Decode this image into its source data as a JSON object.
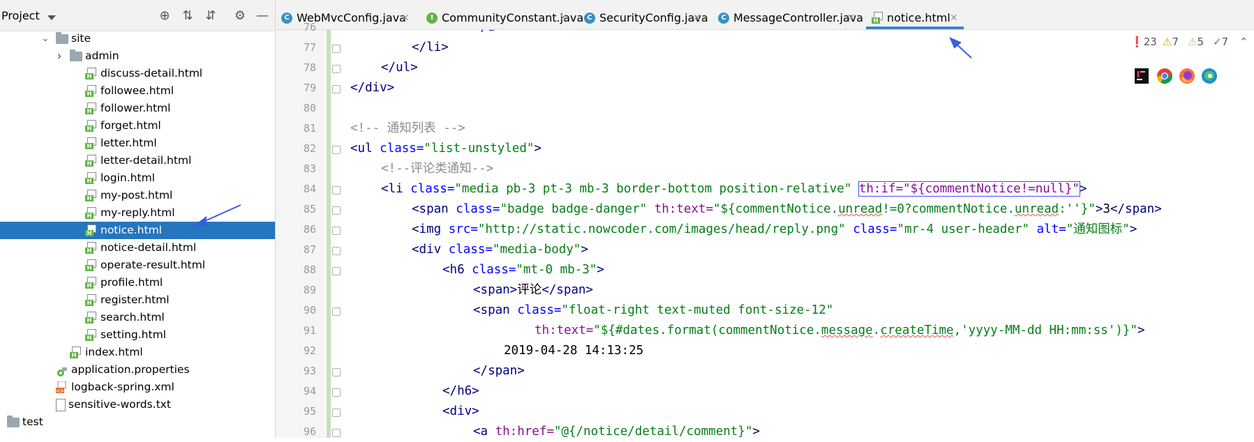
{
  "project_panel": {
    "title": "Project",
    "tree": [
      {
        "label": "site",
        "type": "folder",
        "expanded": true,
        "level": 4
      },
      {
        "label": "admin",
        "type": "folder",
        "expanded": false,
        "level": 5
      },
      {
        "label": "discuss-detail.html",
        "type": "html",
        "level": 6
      },
      {
        "label": "followee.html",
        "type": "html",
        "level": 6
      },
      {
        "label": "follower.html",
        "type": "html",
        "level": 6
      },
      {
        "label": "forget.html",
        "type": "html",
        "level": 6
      },
      {
        "label": "letter.html",
        "type": "html",
        "level": 6
      },
      {
        "label": "letter-detail.html",
        "type": "html",
        "level": 6
      },
      {
        "label": "login.html",
        "type": "html",
        "level": 6
      },
      {
        "label": "my-post.html",
        "type": "html",
        "level": 6
      },
      {
        "label": "my-reply.html",
        "type": "html",
        "level": 6
      },
      {
        "label": "notice.html",
        "type": "html",
        "level": 6,
        "selected": true
      },
      {
        "label": "notice-detail.html",
        "type": "html",
        "level": 6
      },
      {
        "label": "operate-result.html",
        "type": "html",
        "level": 6
      },
      {
        "label": "profile.html",
        "type": "html",
        "level": 6
      },
      {
        "label": "register.html",
        "type": "html",
        "level": 6
      },
      {
        "label": "search.html",
        "type": "html",
        "level": 6
      },
      {
        "label": "setting.html",
        "type": "html",
        "level": 6
      },
      {
        "label": "index.html",
        "type": "html",
        "level": 5
      },
      {
        "label": "application.properties",
        "type": "properties",
        "level": 4
      },
      {
        "label": "logback-spring.xml",
        "type": "xml",
        "level": 4
      },
      {
        "label": "sensitive-words.txt",
        "type": "txt",
        "level": 4
      },
      {
        "label": "test",
        "type": "folder",
        "expanded": true,
        "level": 1
      }
    ]
  },
  "tabs": [
    {
      "label": "WebMvcConfig.java",
      "icon": "class-icon",
      "icon_letter": "C"
    },
    {
      "label": "CommunityConstant.java",
      "icon": "interface-icon",
      "icon_letter": "I"
    },
    {
      "label": "SecurityConfig.java",
      "icon": "class-icon",
      "icon_letter": "C"
    },
    {
      "label": "MessageController.java",
      "icon": "class-icon",
      "icon_letter": "C"
    },
    {
      "label": "notice.html",
      "icon": "html-file-icon",
      "active": true
    }
  ],
  "inspections": {
    "errors": "23",
    "warnings": "7",
    "weak_warnings": "5",
    "typos": "7"
  },
  "editor": {
    "lines": [
      {
        "no": "76",
        "indent": 7,
        "tokens": [
          [
            "tag",
            "</a>"
          ]
        ]
      },
      {
        "no": "77",
        "indent": 5,
        "tokens": [
          [
            "tag",
            "</li>"
          ]
        ]
      },
      {
        "no": "78",
        "indent": 4,
        "tokens": [
          [
            "tag",
            "</ul>"
          ]
        ]
      },
      {
        "no": "79",
        "indent": 3,
        "tokens": [
          [
            "tag",
            "</div>"
          ]
        ]
      },
      {
        "no": "80",
        "indent": 0,
        "tokens": []
      },
      {
        "no": "81",
        "indent": 3,
        "tokens": [
          [
            "cmt",
            "<!-- 通知列表 -->"
          ]
        ]
      },
      {
        "no": "82",
        "indent": 3,
        "tokens": [
          [
            "tag",
            "<ul "
          ],
          [
            "attr",
            "class="
          ],
          [
            "val",
            "\"list-unstyled\""
          ],
          [
            "tag",
            ">"
          ]
        ]
      },
      {
        "no": "83",
        "indent": 4,
        "tokens": [
          [
            "cmt",
            "<!--评论类通知-->"
          ]
        ]
      },
      {
        "no": "84",
        "indent": 4,
        "tokens": [
          [
            "tag",
            "<li "
          ],
          [
            "attr",
            "class="
          ],
          [
            "val",
            "\"media pb-3 pt-3 mb-3 border-bottom position-relative\" "
          ],
          [
            "th_box",
            "th:if=\"${commentNotice!=null}\""
          ],
          [
            "tag",
            ">"
          ]
        ]
      },
      {
        "no": "85",
        "indent": 5,
        "tokens": [
          [
            "tag",
            "<span "
          ],
          [
            "attr",
            "class="
          ],
          [
            "val",
            "\"badge badge-danger\" "
          ],
          [
            "th",
            "th:text="
          ],
          [
            "val",
            "\"${commentNotice."
          ],
          [
            "val_typo",
            "unread"
          ],
          [
            "val",
            "!=0?commentNotice."
          ],
          [
            "val_typo",
            "unread"
          ],
          [
            "val",
            ":''}\""
          ],
          [
            "tag",
            ">"
          ],
          [
            "txt",
            "3"
          ],
          [
            "tag",
            "</span>"
          ]
        ]
      },
      {
        "no": "86",
        "indent": 5,
        "tokens": [
          [
            "tag",
            "<img "
          ],
          [
            "attr",
            "src="
          ],
          [
            "val",
            "\"http://static.nowcoder.com/images/head/reply.png\" "
          ],
          [
            "attr",
            "class="
          ],
          [
            "val",
            "\"mr-4 user-header\" "
          ],
          [
            "attr",
            "alt="
          ],
          [
            "val",
            "\"通知图标\""
          ],
          [
            "tag",
            ">"
          ]
        ]
      },
      {
        "no": "87",
        "indent": 5,
        "tokens": [
          [
            "tag",
            "<div "
          ],
          [
            "attr",
            "class="
          ],
          [
            "val",
            "\"media-body\""
          ],
          [
            "tag",
            ">"
          ]
        ]
      },
      {
        "no": "88",
        "indent": 6,
        "tokens": [
          [
            "tag",
            "<h6 "
          ],
          [
            "attr",
            "class="
          ],
          [
            "val",
            "\"mt-0 mb-3\""
          ],
          [
            "tag",
            ">"
          ]
        ]
      },
      {
        "no": "89",
        "indent": 7,
        "tokens": [
          [
            "tag",
            "<span>"
          ],
          [
            "txt",
            "评论"
          ],
          [
            "tag",
            "</span>"
          ]
        ]
      },
      {
        "no": "90",
        "indent": 7,
        "tokens": [
          [
            "tag",
            "<span "
          ],
          [
            "attr",
            "class="
          ],
          [
            "val",
            "\"float-right text-muted font-size-12\""
          ]
        ]
      },
      {
        "no": "91",
        "indent": 9,
        "tokens": [
          [
            "th",
            "th:text="
          ],
          [
            "val",
            "\"${#dates.format(commentNotice."
          ],
          [
            "val_typo",
            "message"
          ],
          [
            "val",
            "."
          ],
          [
            "val_typo",
            "createTime"
          ],
          [
            "val",
            ",'yyyy-MM-dd HH:mm:ss')}\""
          ],
          [
            "tag",
            ">"
          ]
        ]
      },
      {
        "no": "92",
        "indent": 8,
        "tokens": [
          [
            "txt",
            "2019-04-28 14:13:25"
          ]
        ]
      },
      {
        "no": "93",
        "indent": 7,
        "tokens": [
          [
            "tag",
            "</span>"
          ]
        ]
      },
      {
        "no": "94",
        "indent": 6,
        "tokens": [
          [
            "tag",
            "</h6>"
          ]
        ]
      },
      {
        "no": "95",
        "indent": 6,
        "tokens": [
          [
            "tag",
            "<div>"
          ]
        ]
      },
      {
        "no": "96",
        "indent": 7,
        "tokens": [
          [
            "tag",
            "<a "
          ],
          [
            "th",
            "th:href="
          ],
          [
            "val",
            "\"@{/notice/detail/comment}\""
          ],
          [
            "tag",
            ">"
          ]
        ]
      }
    ]
  },
  "colors": {
    "selection": "#2675bf",
    "accent": "#4083c9",
    "tag": "#000080",
    "attr": "#0000ff",
    "value": "#067d17",
    "comment": "#8c8c8c",
    "thymeleaf": "#871094",
    "arrow": "#3a5bd9"
  }
}
